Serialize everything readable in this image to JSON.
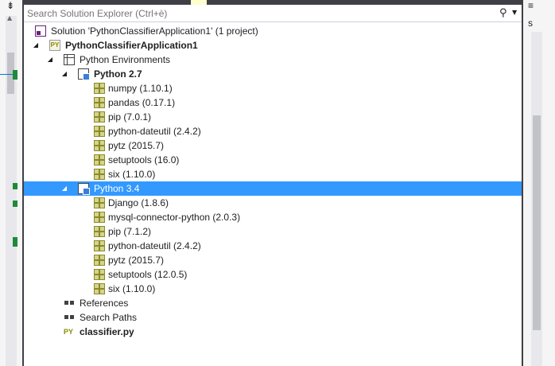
{
  "search": {
    "placeholder": "Search Solution Explorer (Ctrl+è)"
  },
  "right_strip": {
    "text": "s"
  },
  "tree": {
    "solution": "Solution 'PythonClassifierApplication1' (1 project)",
    "project": "PythonClassifierApplication1",
    "python_environments": "Python Environments",
    "py27": {
      "label": "Python 2.7",
      "packages": [
        "numpy (1.10.1)",
        "pandas (0.17.1)",
        "pip (7.0.1)",
        "python-dateutil (2.4.2)",
        "pytz (2015.7)",
        "setuptools (16.0)",
        "six (1.10.0)"
      ]
    },
    "py34": {
      "label": "Python 3.4",
      "packages": [
        "Django (1.8.6)",
        "mysql-connector-python (2.0.3)",
        "pip (7.1.2)",
        "python-dateutil (2.4.2)",
        "pytz (2015.7)",
        "setuptools (12.0.5)",
        "six (1.10.0)"
      ]
    },
    "references": "References",
    "search_paths": "Search Paths",
    "file": "classifier.py",
    "py_icon_text": "PY"
  },
  "colors": {
    "selection": "#3399ff",
    "frame": "#3f3f46"
  }
}
